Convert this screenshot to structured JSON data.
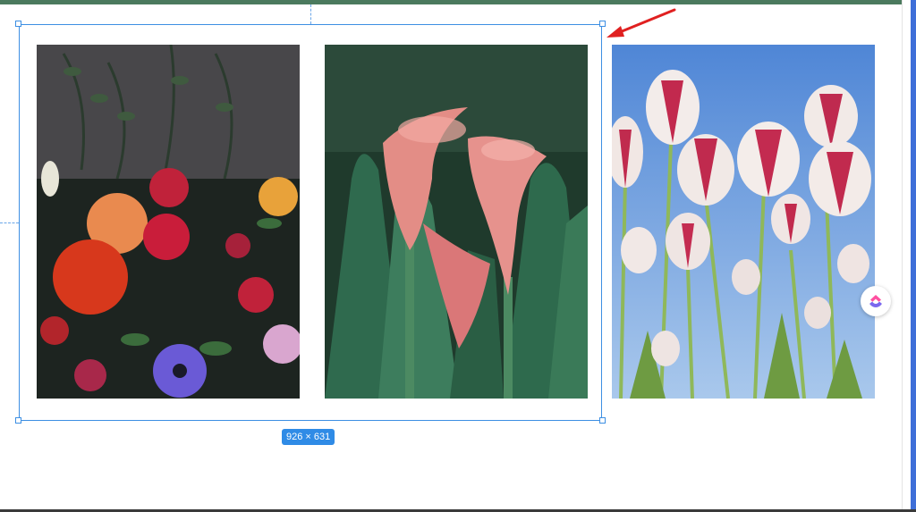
{
  "canvas": {
    "selection_size_label": "926 × 631",
    "accent_color": "#2f8be6",
    "top_bar_color": "#4b7a5e"
  },
  "images": [
    {
      "name": "flower-bouquet-photo"
    },
    {
      "name": "calla-lily-photo"
    },
    {
      "name": "tulips-photo"
    }
  ],
  "annotation": {
    "arrow_color": "#e02020"
  },
  "app": {
    "floating_button_icon": "clickup-logo-icon"
  }
}
